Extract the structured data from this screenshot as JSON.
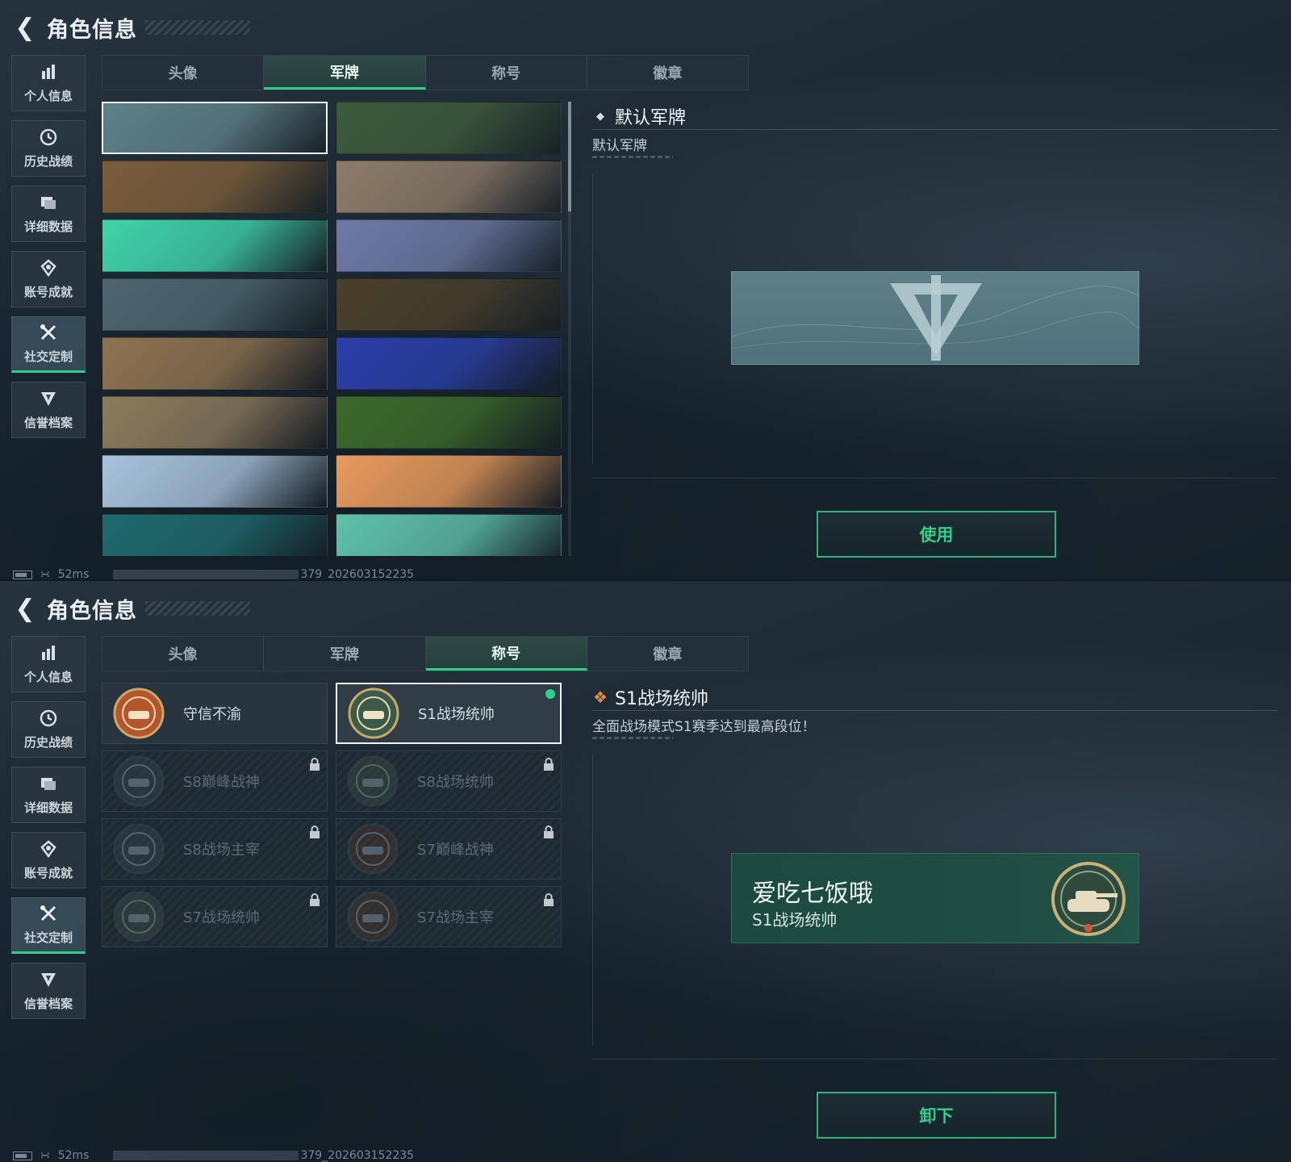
{
  "header": {
    "title": "角色信息"
  },
  "sidebar": {
    "items": [
      {
        "label": "个人信息",
        "icon": "bar-chart-icon"
      },
      {
        "label": "历史战绩",
        "icon": "clock-icon"
      },
      {
        "label": "详细数据",
        "icon": "folder-icon"
      },
      {
        "label": "账号成就",
        "icon": "trophy-icon"
      },
      {
        "label": "社交定制",
        "icon": "tools-icon",
        "active": true
      },
      {
        "label": "信誉档案",
        "icon": "shield-icon"
      }
    ]
  },
  "tabs": [
    "头像",
    "军牌",
    "称号",
    "徽章"
  ],
  "screen1": {
    "active_tab": "军牌",
    "detail": {
      "name": "默认军牌",
      "desc": "默认军牌"
    },
    "action": "使用",
    "cards": [
      {
        "color": "#5e8087",
        "theme": "default-logo",
        "selected": true
      },
      {
        "color": "#3d5a3a",
        "theme": "soldier-camo"
      },
      {
        "color": "#7b5d3a",
        "theme": "helicopter-sunset"
      },
      {
        "color": "#8d7b68",
        "theme": "desert-tank"
      },
      {
        "color": "#3fd3a8",
        "theme": "green-graffiti"
      },
      {
        "color": "#6e7aa6",
        "theme": "paratroopers"
      },
      {
        "color": "#4d6670",
        "theme": "helicopter-storm"
      },
      {
        "color": "#4a3f2a",
        "theme": "weapons-table"
      },
      {
        "color": "#8f7350",
        "theme": "plane-field"
      },
      {
        "color": "#2a3fa8",
        "theme": "blue-orange-face"
      },
      {
        "color": "#8c7a5c",
        "theme": "sniper-ruins"
      },
      {
        "color": "#3c6a2a",
        "theme": "night-vision-squad"
      },
      {
        "color": "#a8c3dc",
        "theme": "rocket-soldier"
      },
      {
        "color": "#e89a5c",
        "theme": "orange-blue-art"
      },
      {
        "color": "#1f6a6e",
        "theme": "teal-soldier"
      },
      {
        "color": "#5fc2a8",
        "theme": "headphones-anime"
      }
    ]
  },
  "screen2": {
    "active_tab": "称号",
    "detail": {
      "name": "S1战场统帅",
      "desc": "全面战场模式S1赛季达到最高段位！"
    },
    "plate": {
      "player_name": "爱吃七饭哦",
      "title": "S1战场统帅"
    },
    "action": "卸下",
    "titles": [
      {
        "label": "守信不渝",
        "locked": false,
        "emblem": "scales-emblem-icon"
      },
      {
        "label": "S1战场统帅",
        "locked": false,
        "selected": true,
        "equipped": true,
        "emblem": "tank-emblem-icon"
      },
      {
        "label": "S8巅峰战神",
        "locked": true,
        "emblem": "stripes-emblem-icon"
      },
      {
        "label": "S8战场统帅",
        "locked": true,
        "emblem": "tank-emblem-icon"
      },
      {
        "label": "S8战场主宰",
        "locked": true,
        "emblem": "building-emblem-icon"
      },
      {
        "label": "S7巅峰战神",
        "locked": true,
        "emblem": "jet-emblem-icon"
      },
      {
        "label": "S7战场统帅",
        "locked": true,
        "emblem": "tank-emblem-icon"
      },
      {
        "label": "S7战场主宰",
        "locked": true,
        "emblem": "soldier-emblem-icon"
      }
    ]
  },
  "status": {
    "ping": "52ms",
    "uid": "379_202603152235"
  },
  "colors": {
    "accent": "#2fd18a",
    "title_icon": "#e8884a"
  }
}
